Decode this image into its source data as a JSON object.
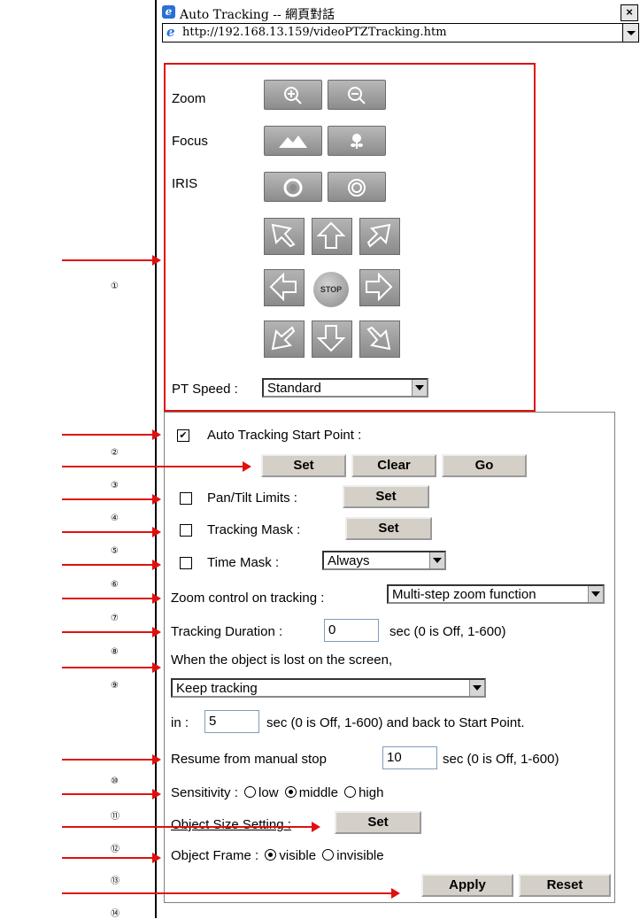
{
  "window": {
    "title": "Auto Tracking -- 網頁對話",
    "url": "http://192.168.13.159/videoPTZTracking.htm",
    "close": "×"
  },
  "ptz": {
    "zoom_label": "Zoom",
    "focus_label": "Focus",
    "iris_label": "IRIS",
    "stop_label": "STOP",
    "pt_speed_label": "PT Speed :",
    "pt_speed_value": "Standard"
  },
  "tracking": {
    "start_point_label": "Auto Tracking Start Point :",
    "start_point_checked": true,
    "set": "Set",
    "clear": "Clear",
    "go": "Go",
    "pan_tilt_label": "Pan/Tilt Limits :",
    "tracking_mask_label": "Tracking Mask :",
    "time_mask_label": "Time Mask :",
    "time_mask_value": "Always",
    "zoom_control_label": "Zoom control on tracking :",
    "zoom_control_value": "Multi-step zoom function",
    "duration_label": "Tracking Duration :",
    "duration_value": "0",
    "duration_hint": "sec (0 is Off, 1-600)",
    "lost_label": "When the object is lost on the screen,",
    "lost_value": "Keep tracking",
    "in_label": "in :",
    "in_value": "5",
    "in_hint": "sec (0 is Off, 1-600)  and back to Start Point.",
    "resume_label": "Resume from manual stop",
    "resume_value": "10",
    "resume_hint": "sec (0 is Off, 1-600)",
    "sensitivity_label": "Sensitivity :",
    "sens_low": "low",
    "sens_middle": "middle",
    "sens_high": "high",
    "object_size_label": "Object Size Setting :",
    "object_frame_label": "Object Frame :",
    "frame_visible": "visible",
    "frame_invisible": "invisible",
    "apply": "Apply",
    "reset": "Reset"
  },
  "markers": [
    "①",
    "②",
    "③",
    "④",
    "⑤",
    "⑥",
    "⑦",
    "⑧",
    "⑨",
    "⑩",
    "⑪",
    "⑫",
    "⑬",
    "⑭"
  ],
  "colors": {
    "annotation_red": "#e01010",
    "button_grey": "#a0a0a0"
  }
}
